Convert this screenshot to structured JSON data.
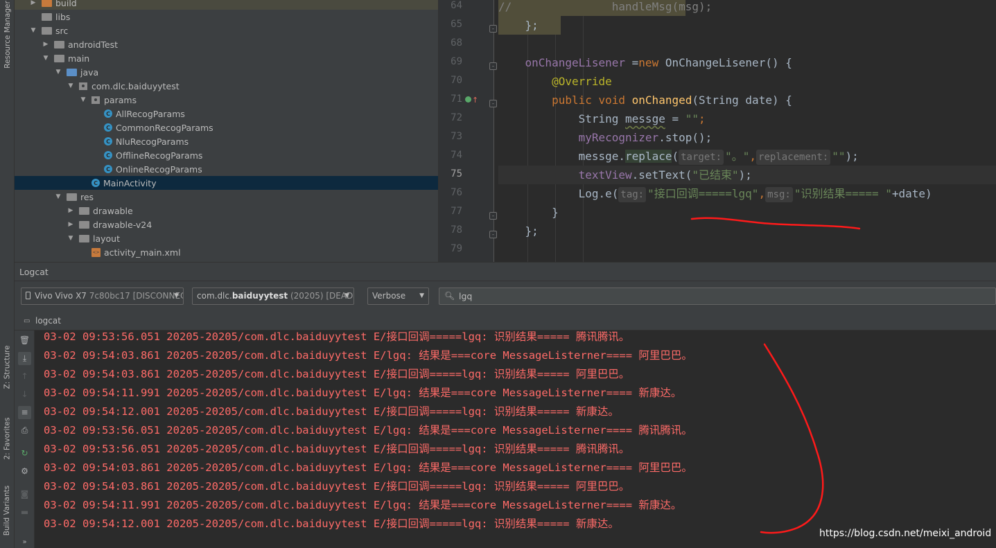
{
  "side_tabs": {
    "resource_manager": "Resource Manager",
    "structure": "Z: Structure",
    "favorites": "2: Favorites",
    "build_variants": "Build Variants"
  },
  "tree": [
    {
      "label": "build",
      "depth": 2,
      "icon": "folder-orange",
      "arrow": "right"
    },
    {
      "label": "libs",
      "depth": 2,
      "icon": "folder",
      "arrow": ""
    },
    {
      "label": "src",
      "depth": 2,
      "icon": "folder",
      "arrow": "down"
    },
    {
      "label": "androidTest",
      "depth": 3,
      "icon": "folder",
      "arrow": "right"
    },
    {
      "label": "main",
      "depth": 3,
      "icon": "folder",
      "arrow": "down"
    },
    {
      "label": "java",
      "depth": 4,
      "icon": "folder-blue",
      "arrow": "down"
    },
    {
      "label": "com.dlc.baiduyytest",
      "depth": 5,
      "icon": "package",
      "arrow": "down"
    },
    {
      "label": "params",
      "depth": 6,
      "icon": "package",
      "arrow": "down"
    },
    {
      "label": "AllRecogParams",
      "depth": 7,
      "icon": "class",
      "arrow": ""
    },
    {
      "label": "CommonRecogParams",
      "depth": 7,
      "icon": "class",
      "arrow": ""
    },
    {
      "label": "NluRecogParams",
      "depth": 7,
      "icon": "class",
      "arrow": ""
    },
    {
      "label": "OfflineRecogParams",
      "depth": 7,
      "icon": "class",
      "arrow": ""
    },
    {
      "label": "OnlineRecogParams",
      "depth": 7,
      "icon": "class",
      "arrow": ""
    },
    {
      "label": "MainActivity",
      "depth": 6,
      "icon": "class",
      "arrow": "",
      "selected": true
    },
    {
      "label": "res",
      "depth": 4,
      "icon": "folder-res",
      "arrow": "down"
    },
    {
      "label": "drawable",
      "depth": 5,
      "icon": "folder",
      "arrow": "right"
    },
    {
      "label": "drawable-v24",
      "depth": 5,
      "icon": "folder",
      "arrow": "right"
    },
    {
      "label": "layout",
      "depth": 5,
      "icon": "folder",
      "arrow": "down"
    },
    {
      "label": "activity_main.xml",
      "depth": 6,
      "icon": "xml",
      "arrow": ""
    }
  ],
  "editor": {
    "line_numbers": [
      "64",
      "65",
      "68",
      "69",
      "70",
      "71",
      "72",
      "73",
      "74",
      "75",
      "76",
      "77",
      "78",
      "79"
    ],
    "current_line": "75",
    "code": {
      "l64_comment": "//",
      "l64_code": "handleMsg(msg);",
      "l65": "};",
      "l69_field": "onChangeLisener",
      "l69_rest": " =",
      "l69_new": "new ",
      "l69_class": "OnChangeLisener() {",
      "l70": "@Override",
      "l71_kw": "public void ",
      "l71_fn": "onChanged",
      "l71_rest": "(String date) {",
      "l72_type": "String ",
      "l72_var": "messge",
      "l72_eq": " = ",
      "l72_str": "\"\"",
      "l72_end": ";",
      "l73_field": "myRecognizer",
      "l73_rest": ".stop();",
      "l74_a": "messge.",
      "l74_b": "replace",
      "l74_c": "(",
      "l74_hint1": "target:",
      "l74_str1": "\"。\"",
      "l74_comma": ",",
      "l74_hint2": "replacement:",
      "l74_str2": "\"\"",
      "l74_end": ");",
      "l75_field": "textView",
      "l75_rest": ".setText(",
      "l75_str": "\"已结束\"",
      "l75_end": ");",
      "l76_a": "Log.e(",
      "l76_hint1": "tag:",
      "l76_str1": "\"接口回调=====lgq\"",
      "l76_comma": ",",
      "l76_hint2": "msg:",
      "l76_str2": "\"识别结果===== \"",
      "l76_end": "+date)",
      "l77": "}",
      "l78": "};"
    }
  },
  "logcat": {
    "title": "Logcat",
    "device": {
      "name": "Vivo Vivo X7",
      "serial": "7c80bc17",
      "status": "[DISCONNECTED]"
    },
    "process": {
      "pkg_prefix": "com.dlc.",
      "pkg_bold": "baiduyytest",
      "pid": "(20205)",
      "status": "[DEAD]"
    },
    "level": "Verbose",
    "search_value": "lgq",
    "subtab": "logcat",
    "lines": [
      "03-02 09:53:56.051 20205-20205/com.dlc.baiduyytest E/接口回调=====lgq: 识别结果===== 腾讯腾讯。",
      "03-02 09:54:03.861 20205-20205/com.dlc.baiduyytest E/lgq: 结果是===core MessageListerner==== 阿里巴巴。",
      "03-02 09:54:03.861 20205-20205/com.dlc.baiduyytest E/接口回调=====lgq: 识别结果===== 阿里巴巴。",
      "03-02 09:54:11.991 20205-20205/com.dlc.baiduyytest E/lgq: 结果是===core MessageListerner==== 新康达。",
      "03-02 09:54:12.001 20205-20205/com.dlc.baiduyytest E/接口回调=====lgq: 识别结果===== 新康达。",
      "03-02 09:53:56.051 20205-20205/com.dlc.baiduyytest E/lgq: 结果是===core MessageListerner==== 腾讯腾讯。",
      "03-02 09:53:56.051 20205-20205/com.dlc.baiduyytest E/接口回调=====lgq: 识别结果===== 腾讯腾讯。",
      "03-02 09:54:03.861 20205-20205/com.dlc.baiduyytest E/lgq: 结果是===core MessageListerner==== 阿里巴巴。",
      "03-02 09:54:03.861 20205-20205/com.dlc.baiduyytest E/接口回调=====lgq: 识别结果===== 阿里巴巴。",
      "03-02 09:54:11.991 20205-20205/com.dlc.baiduyytest E/lgq: 结果是===core MessageListerner==== 新康达。",
      "03-02 09:54:12.001 20205-20205/com.dlc.baiduyytest E/接口回调=====lgq: 识别结果===== 新康达。"
    ]
  },
  "watermark": "https://blog.csdn.net/meixi_android",
  "colors": {
    "log_error": "#ff6b68",
    "annotation_ink": "#ff1a1a",
    "selection": "#0d293e"
  }
}
